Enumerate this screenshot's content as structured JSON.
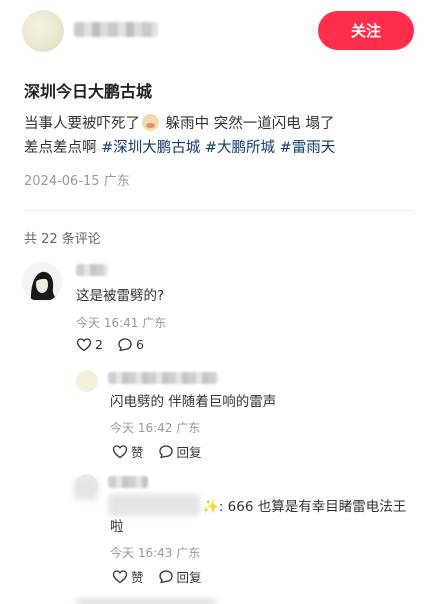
{
  "header": {
    "follow_label": "关注"
  },
  "post": {
    "title": "深圳今日大鹏古城",
    "line1_text": "当事人要被吓死了",
    "line1_rest": " 躲雨中 突然一道闪电 塌了",
    "line2_text": "差点差点啊 ",
    "tags": [
      "#深圳大鹏古城",
      "#大鹏所城",
      "#雷雨天"
    ],
    "date": "2024-06-15",
    "location": "广东"
  },
  "comments_header": {
    "count_text": "共 22 条评论"
  },
  "comments": [
    {
      "text": "这是被雷劈的?",
      "time": "今天 16:41",
      "location": "广东",
      "likes": "2",
      "replies": "6"
    },
    {
      "text": "闪电劈的 伴随着巨响的雷声",
      "time": "今天 16:42",
      "location": "广东",
      "like_label": "赞",
      "reply_label": "回复"
    },
    {
      "text_line1": ": 666 也算是有幸目睹雷电法王",
      "text_line2": "啦",
      "time": "今天 16:43",
      "location": "广东",
      "like_label": "赞",
      "reply_label": "回复"
    }
  ],
  "colors": {
    "follow_button": "#ff2e4d",
    "hashtag": "#13386c",
    "meta_gray": "#999999"
  },
  "icons": [
    "heart-icon",
    "comment-bubble-icon"
  ]
}
